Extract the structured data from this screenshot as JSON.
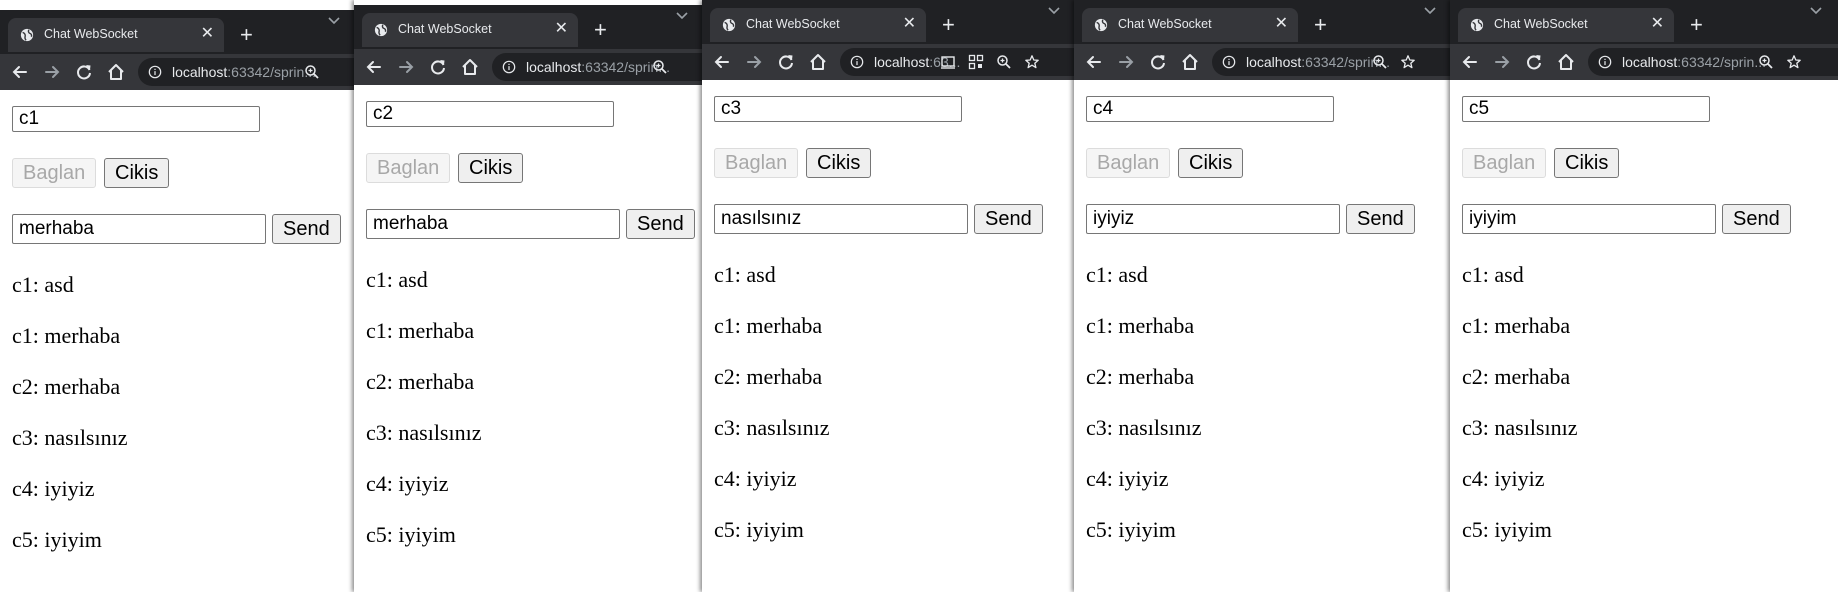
{
  "colors": {
    "tabstrip": "#202124",
    "tab_active": "#35363a",
    "toolbar": "#35363a",
    "omnibox": "#202124",
    "icon": "#e8eaed",
    "icon_dim": "#9aa0a6"
  },
  "icons": {
    "tab_favicon": "globe-icon",
    "tab_close": "close-icon",
    "new_tab": "plus-icon",
    "tab_search": "chevron-down-icon",
    "back": "arrow-left-icon",
    "forward": "arrow-right-icon",
    "reload": "reload-icon",
    "home": "home-icon",
    "site_info": "info-icon",
    "zoom": "zoom-icon",
    "bookmark": "star-icon",
    "cast": "cast-icon",
    "qr": "qr-code-icon"
  },
  "windows": [
    {
      "tab_title": "Chat WebSocket",
      "tab_close": "✕",
      "new_tab": "+",
      "url_host": "localhost",
      "url_rest": ":63342/sprin...",
      "name_value": "c1",
      "connect_label": "Baglan",
      "disconnect_label": "Cikis",
      "message_value": "merhaba",
      "send_label": "Send",
      "messages": [
        "c1: asd",
        "c1: merhaba",
        "c2: merhaba",
        "c3: nasılsınız",
        "c4: iyiyiz",
        "c5: iyiyim"
      ]
    },
    {
      "tab_title": "Chat WebSocket",
      "tab_close": "✕",
      "new_tab": "+",
      "url_host": "localhost",
      "url_rest": ":63342/sprin...",
      "name_value": "c2",
      "connect_label": "Baglan",
      "disconnect_label": "Cikis",
      "message_value": "merhaba",
      "send_label": "Send",
      "messages": [
        "c1: asd",
        "c1: merhaba",
        "c2: merhaba",
        "c3: nasılsınız",
        "c4: iyiyiz",
        "c5: iyiyim"
      ]
    },
    {
      "tab_title": "Chat WebSocket",
      "tab_close": "✕",
      "new_tab": "+",
      "url_host": "localhost",
      "url_rest": ":63...",
      "name_value": "c3",
      "connect_label": "Baglan",
      "disconnect_label": "Cikis",
      "message_value": "nasılsınız",
      "send_label": "Send",
      "messages": [
        "c1: asd",
        "c1: merhaba",
        "c2: merhaba",
        "c3: nasılsınız",
        "c4: iyiyiz",
        "c5: iyiyim"
      ]
    },
    {
      "tab_title": "Chat WebSocket",
      "tab_close": "✕",
      "new_tab": "+",
      "url_host": "localhost",
      "url_rest": ":63342/sprin...",
      "name_value": "c4",
      "connect_label": "Baglan",
      "disconnect_label": "Cikis",
      "message_value": "iyiyiz",
      "send_label": "Send",
      "messages": [
        "c1: asd",
        "c1: merhaba",
        "c2: merhaba",
        "c3: nasılsınız",
        "c4: iyiyiz",
        "c5: iyiyim"
      ]
    },
    {
      "tab_title": "Chat WebSocket",
      "tab_close": "✕",
      "new_tab": "+",
      "url_host": "localhost",
      "url_rest": ":63342/sprin...",
      "name_value": "c5",
      "connect_label": "Baglan",
      "disconnect_label": "Cikis",
      "message_value": "iyiyim",
      "send_label": "Send",
      "messages": [
        "c1: asd",
        "c1: merhaba",
        "c2: merhaba",
        "c3: nasılsınız",
        "c4: iyiyiz",
        "c5: iyiyim"
      ]
    }
  ]
}
